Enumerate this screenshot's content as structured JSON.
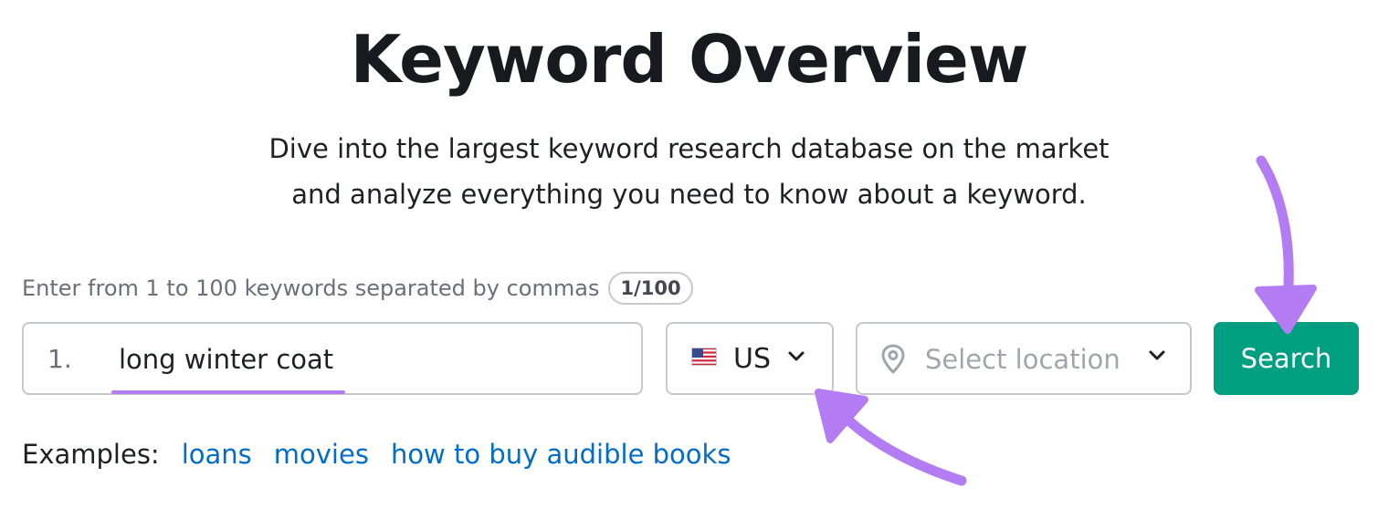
{
  "page": {
    "title": "Keyword Overview",
    "subtitle_line1": "Dive into the largest keyword research database on the market",
    "subtitle_line2": "and analyze everything you need to know about a keyword."
  },
  "keywords": {
    "hint": "Enter from 1 to 100 keywords separated by commas",
    "counter": "1/100",
    "line_number": "1.",
    "value": "long winter coat"
  },
  "database": {
    "flag_icon": "us-flag-icon",
    "code": "US"
  },
  "location": {
    "placeholder": "Select location",
    "icon": "map-pin-icon"
  },
  "search_button": {
    "label": "Search"
  },
  "examples": {
    "label": "Examples:",
    "links": [
      "loans",
      "movies",
      "how to buy audible books"
    ]
  },
  "colors": {
    "accent_green": "#009f81",
    "link_blue": "#006dca",
    "annotation_purple": "#b47cf2",
    "border_gray": "#c7c8ce"
  }
}
